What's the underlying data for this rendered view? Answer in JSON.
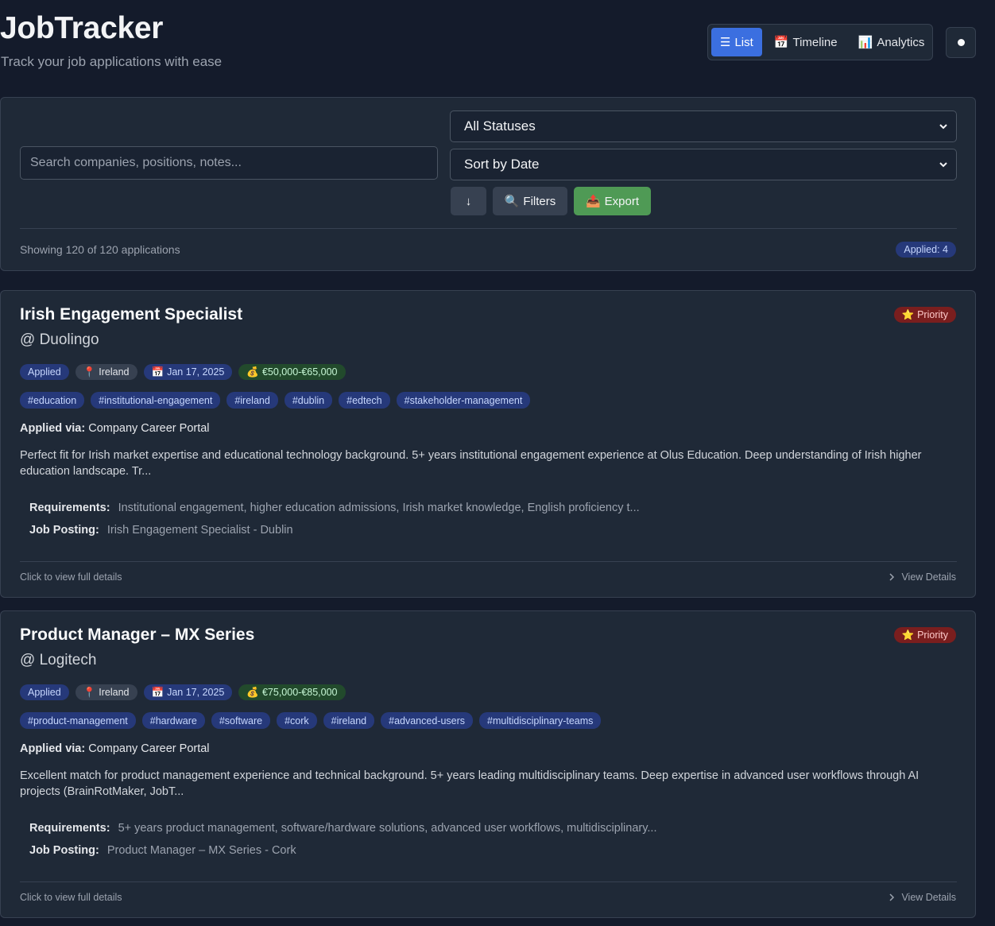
{
  "header": {
    "title": "JobTracker",
    "subtitle": "Track your job applications with ease"
  },
  "views": {
    "list": "List",
    "timeline": "Timeline",
    "analytics": "Analytics",
    "active": "List"
  },
  "filters": {
    "search_placeholder": "Search companies, positions, notes...",
    "status_value": "All Statuses",
    "sort_value": "Sort by Date",
    "order_icon": "↓",
    "filters_label": "Filters",
    "export_label": "Export",
    "showing": "Showing 120 of 120 applications",
    "applied_count": "Applied: 4"
  },
  "jobs": [
    {
      "title": "Irish Engagement Specialist",
      "company": "@ Duolingo",
      "priority": "Priority",
      "status": "Applied",
      "location": "Ireland",
      "date": "Jan 17, 2025",
      "salary": "€50,000-€65,000",
      "tags": [
        "#education",
        "#institutional-engagement",
        "#ireland",
        "#dublin",
        "#edtech",
        "#stakeholder-management"
      ],
      "applied_via_label": "Applied via:",
      "applied_via": "Company Career Portal",
      "description": "Perfect fit for Irish market expertise and educational technology background. 5+ years institutional engagement experience at Olus Education. Deep understanding of Irish higher education landscape. Tr...",
      "requirements_label": "Requirements:",
      "requirements": "Institutional engagement, higher education admissions, Irish market knowledge, English proficiency t...",
      "posting_label": "Job Posting:",
      "posting": "Irish Engagement Specialist - Dublin",
      "footer_left": "Click to view full details",
      "footer_right": "View Details"
    },
    {
      "title": "Product Manager – MX Series",
      "company": "@ Logitech",
      "priority": "Priority",
      "status": "Applied",
      "location": "Ireland",
      "date": "Jan 17, 2025",
      "salary": "€75,000-€85,000",
      "tags": [
        "#product-management",
        "#hardware",
        "#software",
        "#cork",
        "#ireland",
        "#advanced-users",
        "#multidisciplinary-teams"
      ],
      "applied_via_label": "Applied via:",
      "applied_via": "Company Career Portal",
      "description": "Excellent match for product management experience and technical background. 5+ years leading multidisciplinary teams. Deep expertise in advanced user workflows through AI projects (BrainRotMaker, JobT...",
      "requirements_label": "Requirements:",
      "requirements": "5+ years product management, software/hardware solutions, advanced user workflows, multidisciplinary...",
      "posting_label": "Job Posting:",
      "posting": "Product Manager – MX Series - Cork",
      "footer_left": "Click to view full details",
      "footer_right": "View Details"
    }
  ],
  "colors": {
    "background": "#141b2b",
    "panel": "#1f2937",
    "accent": "#3b6fe0",
    "export": "#4f9a55",
    "priority": "#7a1e1e"
  }
}
